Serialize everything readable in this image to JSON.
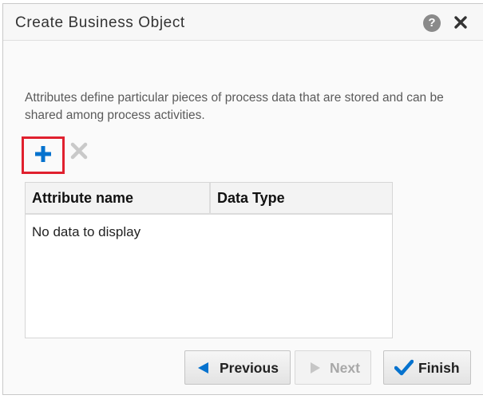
{
  "dialog": {
    "title": "Create Business Object",
    "help_icon": "help-icon",
    "close_icon": "close-icon"
  },
  "description": "Attributes define particular pieces of process data that are stored and can be shared among process activities.",
  "toolbar": {
    "add_icon": "plus-icon",
    "delete_icon": "delete-x-icon",
    "accent_color": "#0572ce",
    "highlight_color": "#e0202e"
  },
  "table": {
    "columns": [
      "Attribute name",
      "Data Type"
    ],
    "empty_text": "No data to display"
  },
  "buttons": {
    "previous": "Previous",
    "next": "Next",
    "finish": "Finish"
  }
}
